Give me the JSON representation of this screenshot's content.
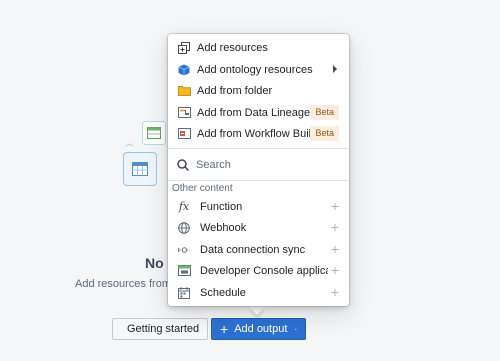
{
  "empty_state": {
    "title": "No r",
    "description": "Add resources from pro"
  },
  "buttons": {
    "getting_started": "Getting started",
    "add_output": "Add output"
  },
  "menu": {
    "items": [
      {
        "label": "Add resources",
        "icon": "add-resources-icon"
      },
      {
        "label": "Add ontology resources",
        "icon": "ontology-cube-icon",
        "has_submenu": true
      },
      {
        "label": "Add from folder",
        "icon": "folder-icon"
      },
      {
        "label": "Add from Data Lineage",
        "icon": "data-lineage-icon",
        "badge": "Beta"
      },
      {
        "label": "Add from Workflow Builder",
        "icon": "workflow-builder-icon",
        "badge": "Beta"
      }
    ],
    "search_placeholder": "Search",
    "other_section_title": "Other content",
    "other_items": [
      {
        "label": "Function",
        "icon": "function-icon"
      },
      {
        "label": "Webhook",
        "icon": "globe-icon"
      },
      {
        "label": "Data connection sync",
        "icon": "data-connection-icon"
      },
      {
        "label": "Developer Console application",
        "icon": "developer-console-icon"
      },
      {
        "label": "Schedule",
        "icon": "calendar-icon"
      }
    ]
  },
  "colors": {
    "primary": "#2d72d2",
    "beta_bg": "#fbeee0",
    "beta_text": "#935610",
    "folder": "#f0b726",
    "ontology": "#2d72d2"
  }
}
